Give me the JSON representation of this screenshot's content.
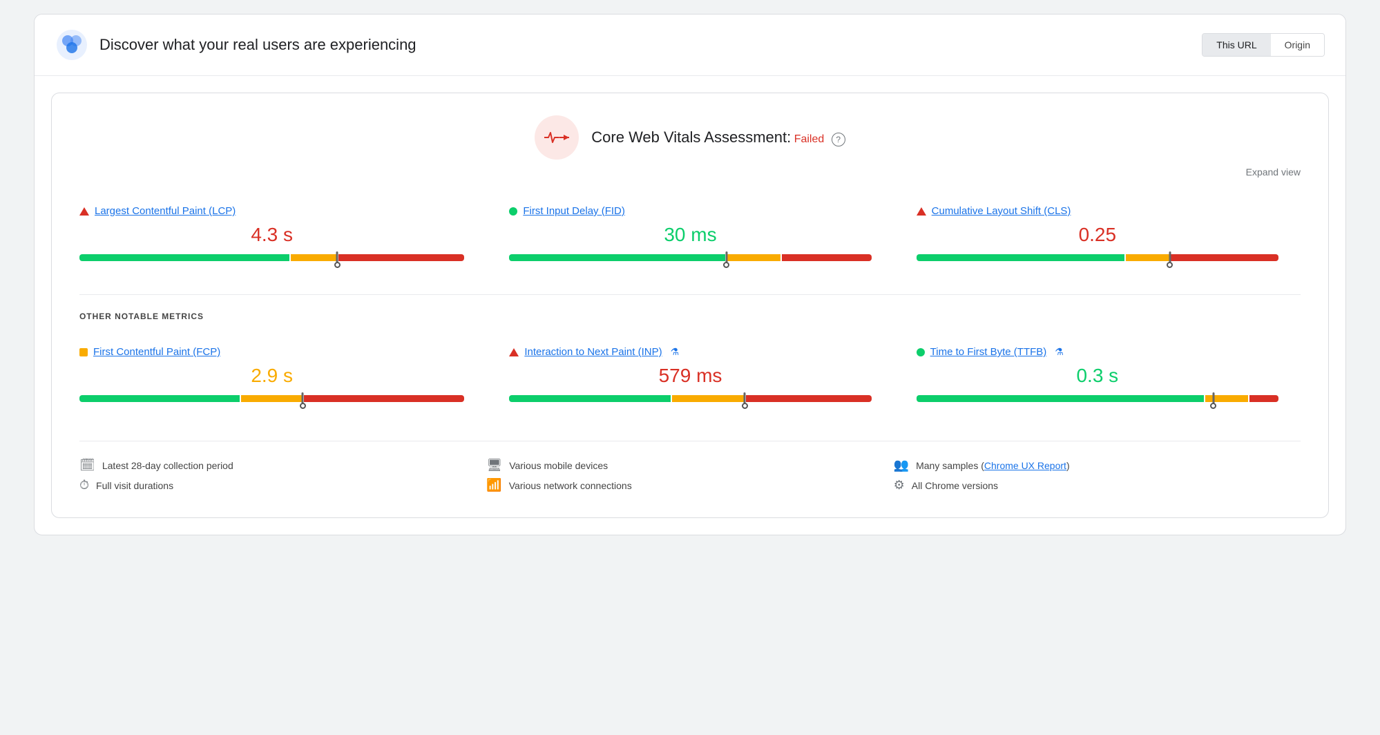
{
  "header": {
    "title": "Discover what your real users are experiencing",
    "tabs": [
      {
        "label": "This URL",
        "active": true
      },
      {
        "label": "Origin",
        "active": false
      }
    ]
  },
  "assessment": {
    "title": "Core Web Vitals Assessment:",
    "status": "Failed",
    "expand_label": "Expand view"
  },
  "core_metrics": [
    {
      "name": "Largest Contentful Paint (LCP)",
      "indicator": "triangle-red",
      "value": "4.3 s",
      "value_color": "red",
      "bar": {
        "green": 55,
        "orange": 12,
        "red": 33,
        "marker_pct": 67
      }
    },
    {
      "name": "First Input Delay (FID)",
      "indicator": "circle-green",
      "value": "30 ms",
      "value_color": "green",
      "bar": {
        "green": 60,
        "orange": 15,
        "red": 25,
        "marker_pct": 60
      }
    },
    {
      "name": "Cumulative Layout Shift (CLS)",
      "indicator": "triangle-red",
      "value": "0.25",
      "value_color": "red",
      "bar": {
        "green": 58,
        "orange": 12,
        "red": 30,
        "marker_pct": 70
      }
    }
  ],
  "other_metrics_label": "OTHER NOTABLE METRICS",
  "other_metrics": [
    {
      "name": "First Contentful Paint (FCP)",
      "indicator": "square-orange",
      "value": "2.9 s",
      "value_color": "orange",
      "bar": {
        "green": 42,
        "orange": 16,
        "red": 42,
        "marker_pct": 58
      },
      "flask": false
    },
    {
      "name": "Interaction to Next Paint (INP)",
      "indicator": "triangle-red",
      "value": "579 ms",
      "value_color": "red",
      "bar": {
        "green": 45,
        "orange": 20,
        "red": 35,
        "marker_pct": 65
      },
      "flask": true
    },
    {
      "name": "Time to First Byte (TTFB)",
      "indicator": "circle-green",
      "value": "0.3 s",
      "value_color": "green",
      "bar": {
        "green": 80,
        "orange": 12,
        "red": 8,
        "marker_pct": 82
      },
      "flask": true
    }
  ],
  "footer": {
    "col1": [
      {
        "icon": "📅",
        "text": "Latest 28-day collection period"
      },
      {
        "icon": "⏱",
        "text": "Full visit durations"
      }
    ],
    "col2": [
      {
        "icon": "💻",
        "text": "Various mobile devices"
      },
      {
        "icon": "📶",
        "text": "Various network connections"
      }
    ],
    "col3": [
      {
        "icon": "👥",
        "text": "Many samples (",
        "link": "Chrome UX Report",
        "text_after": ")"
      },
      {
        "icon": "⚙",
        "text": "All Chrome versions"
      }
    ]
  }
}
